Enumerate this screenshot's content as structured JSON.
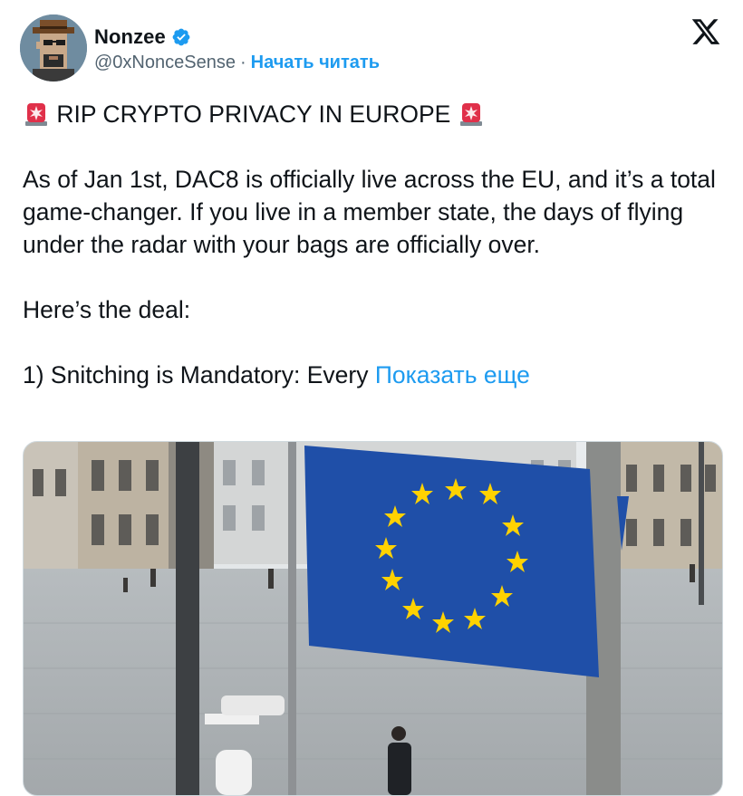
{
  "author": {
    "name": "Nonzee",
    "handle": "@0xNonceSense",
    "separator": "·",
    "follow_label": "Начать читать"
  },
  "icons": {
    "avatar": "pixel-avatar-cowboy-hat",
    "verified": "verified-badge-icon",
    "brand": "x-logo-icon",
    "emoji": "rotating-light-siren-icon"
  },
  "colors": {
    "accent": "#1d9bf0",
    "text": "#0f1419",
    "secondary": "#536471"
  },
  "tweet": {
    "headline": "RIP CRYPTO PRIVACY IN EUROPE",
    "paragraph1": "As of Jan 1st, DAC8 is officially live across the EU, and it’s a total game-changer. If you live in a member state, the days of flying under the radar with your bags are officially over.",
    "paragraph2": "Here’s the deal:",
    "paragraph3": "1) Snitching is Mandatory: Every",
    "show_more": "Показать еще"
  },
  "media": {
    "description_icon": "eu-flag-photo"
  }
}
